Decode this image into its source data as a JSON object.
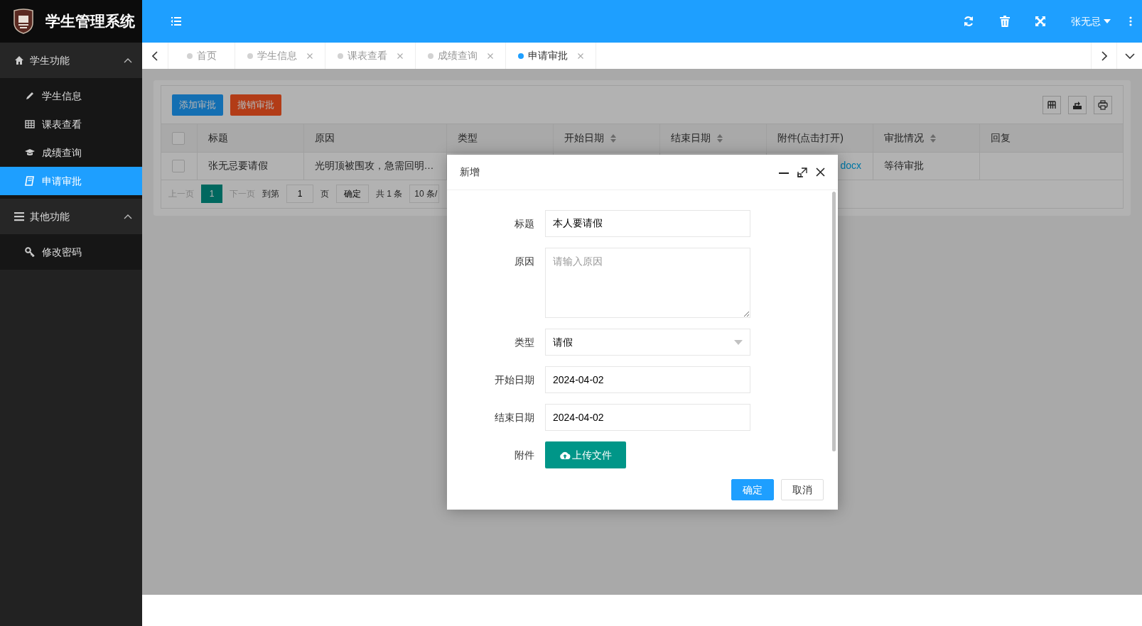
{
  "app": {
    "title": "学生管理系统"
  },
  "header": {
    "user": "张无忌"
  },
  "sidebar": {
    "groups": [
      {
        "label": "学生功能",
        "expanded": true,
        "items": [
          {
            "label": "学生信息",
            "selected": false
          },
          {
            "label": "课表查看",
            "selected": false
          },
          {
            "label": "成绩查询",
            "selected": false
          },
          {
            "label": "申请审批",
            "selected": true
          }
        ]
      },
      {
        "label": "其他功能",
        "expanded": true,
        "items": [
          {
            "label": "修改密码",
            "selected": false
          }
        ]
      }
    ]
  },
  "tabs": [
    {
      "label": "首页",
      "closable": false,
      "selected": false
    },
    {
      "label": "学生信息",
      "closable": true,
      "selected": false
    },
    {
      "label": "课表查看",
      "closable": true,
      "selected": false
    },
    {
      "label": "成绩查询",
      "closable": true,
      "selected": false
    },
    {
      "label": "申请审批",
      "closable": true,
      "selected": true
    }
  ],
  "toolbar": {
    "buttons": [
      {
        "label": "添加审批",
        "kind": "primary"
      },
      {
        "label": "撤销审批",
        "kind": "danger"
      }
    ]
  },
  "table": {
    "select_all": {
      "checked": false
    },
    "columns": [
      {
        "label": "标题",
        "sortable": false
      },
      {
        "label": "原因",
        "sortable": false
      },
      {
        "label": "类型",
        "sortable": false
      },
      {
        "label": "开始日期",
        "sortable": true
      },
      {
        "label": "结束日期",
        "sortable": true
      },
      {
        "label": "附件(点击打开)",
        "sortable": false
      },
      {
        "label": "审批情况",
        "sortable": true
      },
      {
        "label": "回复",
        "sortable": false
      }
    ],
    "rows": [
      {
        "checked": false,
        "title": "张无忌要请假",
        "reason": "光明顶被围攻，急需回明…",
        "attachment": "docx",
        "status": "等待审批"
      }
    ]
  },
  "pager": {
    "prev": {
      "label": "上一页",
      "disabled": true
    },
    "pages": [
      {
        "label": "1",
        "selected": true
      }
    ],
    "next": {
      "label": "下一页",
      "disabled": true
    },
    "goto_label": "到第",
    "goto_value": "1",
    "page_unit": "页",
    "confirm": "确定",
    "total": "共 1 条",
    "page_size": "10 条/"
  },
  "modal": {
    "title": "新增",
    "fields": [
      {
        "label": "标题",
        "kind": "text",
        "value": "本人要请假"
      },
      {
        "label": "原因",
        "kind": "textarea",
        "placeholder": "请输入原因"
      },
      {
        "label": "类型",
        "kind": "select",
        "value": "请假"
      },
      {
        "label": "开始日期",
        "kind": "text",
        "value": "2024-04-02"
      },
      {
        "label": "结束日期",
        "kind": "text",
        "value": "2024-04-02"
      },
      {
        "label": "附件",
        "kind": "upload",
        "button": "上传文件"
      }
    ],
    "buttons": [
      {
        "label": "确定",
        "kind": "primary"
      },
      {
        "label": "取消",
        "kind": "default"
      }
    ]
  }
}
